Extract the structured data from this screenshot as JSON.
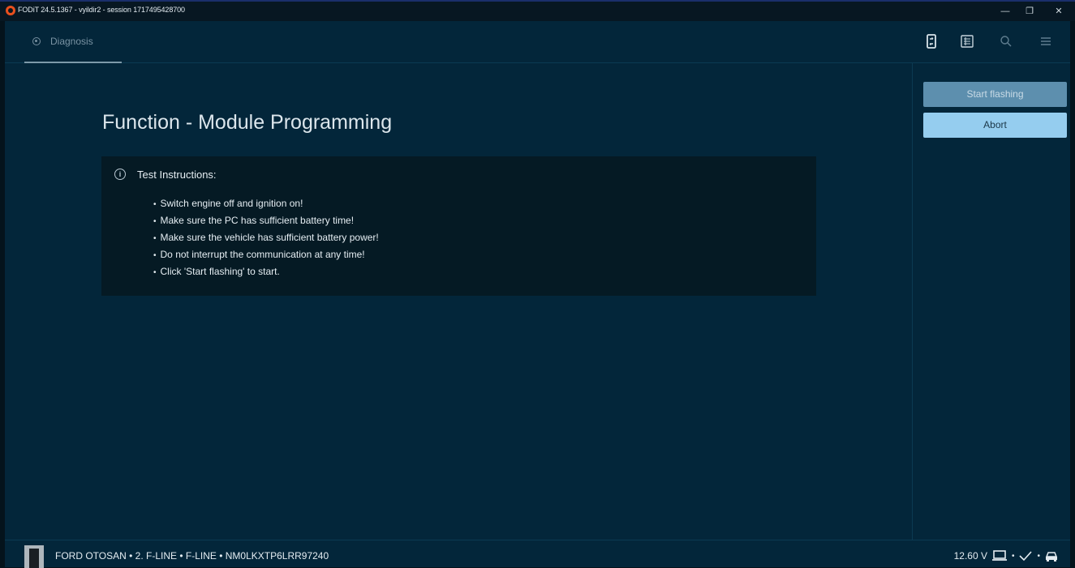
{
  "window": {
    "title": "FODiT 24.5.1367 - vyildir2 - session 1717495428700",
    "minimize_label": "—",
    "restore_label": "❐",
    "close_label": "✕"
  },
  "nav": {
    "tab_diagnosis": "Diagnosis",
    "icons": [
      "vci-connection-icon",
      "document-list-icon",
      "search-icon",
      "menu-icon"
    ]
  },
  "page": {
    "title": "Function - Module Programming"
  },
  "instructions": {
    "heading": "Test Instructions:",
    "items": [
      "Switch engine off and ignition on!",
      "Make sure the PC has sufficient battery time!",
      "Make sure the vehicle has sufficient battery power!",
      "Do not interrupt the communication at any time!",
      "Click 'Start flashing' to start."
    ]
  },
  "side": {
    "start_label": "Start flashing",
    "abort_label": "Abort"
  },
  "status": {
    "vehicle": "FORD OTOSAN • 2. F-LINE • F-LINE • NM0LKXTP6LRR97240",
    "voltage": "12.60 V",
    "sep": "•"
  },
  "colors": {
    "background": "#03263a",
    "accent_button": "#95cdef",
    "disabled_button": "#5d8fae",
    "logo": "#e8501e"
  }
}
